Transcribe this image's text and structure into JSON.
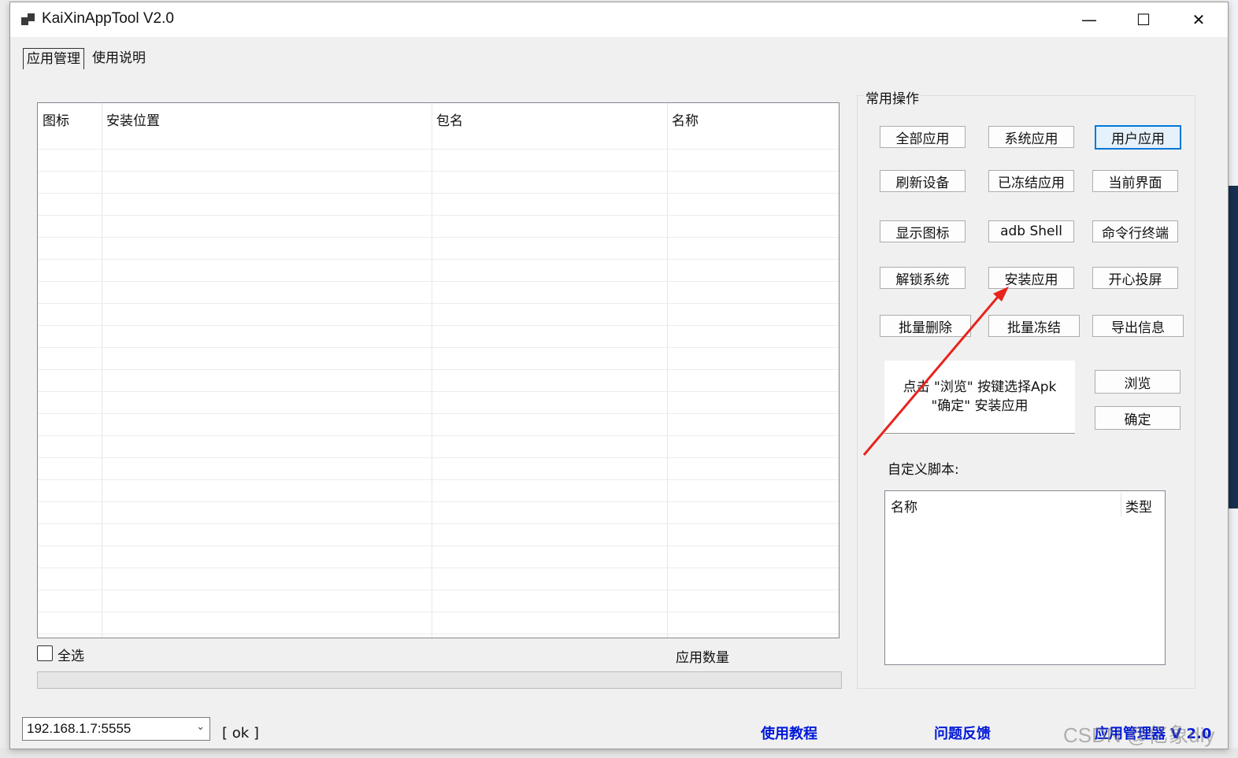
{
  "window": {
    "title": "KaiXinAppTool V2.0",
    "controls": {
      "minimize": "—",
      "maximize": "☐",
      "close": "✕"
    }
  },
  "tabs": [
    {
      "label": "应用管理",
      "active": true
    },
    {
      "label": "使用说明",
      "active": false
    }
  ],
  "app_list": {
    "columns": [
      "图标",
      "安装位置",
      "包名",
      "名称"
    ],
    "rows": []
  },
  "select_all_label": "全选",
  "app_count_label": "应用数量",
  "common_ops": {
    "title": "常用操作",
    "buttons": [
      [
        "全部应用",
        "系统应用",
        "用户应用"
      ],
      [
        "刷新设备",
        "已冻结应用",
        "当前界面"
      ],
      [
        "显示图标",
        "adb Shell",
        "命令行终端"
      ],
      [
        "解锁系统",
        "安装应用",
        "开心投屏"
      ],
      [
        "批量删除",
        "批量冻结",
        "导出信息"
      ]
    ],
    "selected": "用户应用"
  },
  "install": {
    "hint_line1": "点击 \"浏览\" 按键选择Apk",
    "hint_line2": "\"确定\" 安装应用",
    "browse": "浏览",
    "confirm": "确定"
  },
  "script": {
    "label": "自定义脚本:",
    "columns": [
      "名称",
      "类型"
    ]
  },
  "footer": {
    "device": "192.168.1.7:5555",
    "status": "[ ok ]",
    "links": [
      "使用教程",
      "问题反馈",
      "应用管理器 V 2.0"
    ]
  },
  "watermark": "CSDN @亿象diy",
  "colors": {
    "link": "#0018d8",
    "arrow": "#e8231d",
    "selected_border": "#0078d7"
  }
}
